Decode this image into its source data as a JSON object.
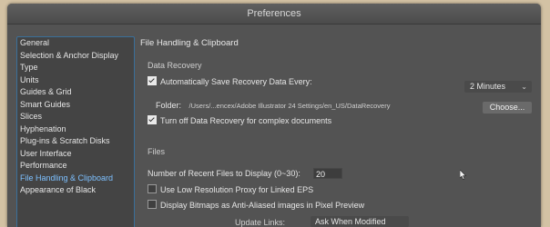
{
  "window": {
    "title": "Preferences"
  },
  "sidebar": {
    "items": [
      {
        "label": "General"
      },
      {
        "label": "Selection & Anchor Display"
      },
      {
        "label": "Type"
      },
      {
        "label": "Units"
      },
      {
        "label": "Guides & Grid"
      },
      {
        "label": "Smart Guides"
      },
      {
        "label": "Slices"
      },
      {
        "label": "Hyphenation"
      },
      {
        "label": "Plug-ins & Scratch Disks"
      },
      {
        "label": "User Interface"
      },
      {
        "label": "Performance"
      },
      {
        "label": "File Handling & Clipboard",
        "selected": true
      },
      {
        "label": "Appearance of Black"
      }
    ]
  },
  "main": {
    "section_title": "File Handling & Clipboard",
    "data_recovery": {
      "group_title": "Data Recovery",
      "auto_save_label": "Automatically Save Recovery Data Every:",
      "auto_save_checked": true,
      "interval_value": "2 Minutes",
      "folder_label": "Folder:",
      "folder_path": "/Users/...encex/Adobe Illustrator 24 Settings/en_US/DataRecovery",
      "choose_label": "Choose...",
      "turn_off_label": "Turn off Data Recovery for complex documents",
      "turn_off_checked": true
    },
    "files": {
      "group_title": "Files",
      "recent_label": "Number of Recent Files to Display (0~30):",
      "recent_value": "20",
      "low_res_label": "Use Low Resolution Proxy for Linked EPS",
      "low_res_checked": false,
      "antialias_label": "Display Bitmaps as Anti-Aliased images in Pixel Preview",
      "antialias_checked": false,
      "update_links_label": "Update Links:",
      "update_links_value": "Ask When Modified"
    }
  }
}
